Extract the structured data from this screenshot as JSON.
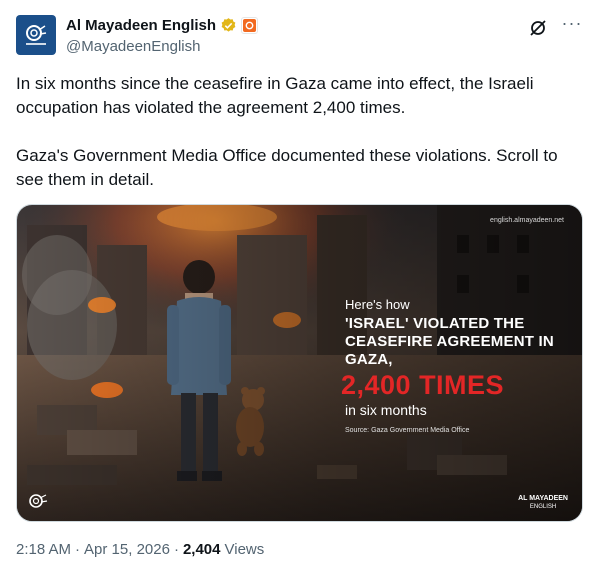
{
  "account": {
    "display_name": "Al Mayadeen English",
    "handle": "@MayadeenEnglish"
  },
  "tweet": {
    "paragraph1": "In six months since the ceasefire in Gaza came into effect, the Israeli occupation has violated the agreement 2,400 times.",
    "paragraph2": "Gaza's Government Media Office documented these violations. Scroll to see them in detail."
  },
  "media_text": {
    "url": "english.almayadeen.net",
    "intro": "Here's how",
    "headline": "'ISRAEL' VIOLATED THE CEASEFIRE AGREEMENT IN GAZA,",
    "count": "2,400 TIMES",
    "period": "in six months",
    "source": "Source: Gaza Government Media Office",
    "brand": "AL MAYADEEN",
    "brand_sub": "ENGLISH"
  },
  "meta": {
    "time": "2:18 AM",
    "date": "Apr 15, 2026",
    "separator": "·",
    "views_count": "2,404",
    "views_label": "Views"
  },
  "colors": {
    "verified_gold": "#e2b719",
    "accent_red": "#e32626",
    "avatar_blue": "#1b4f8a"
  },
  "icons": [
    "verified-badge-icon",
    "affiliate-badge-icon",
    "grok-icon",
    "more-icon"
  ]
}
